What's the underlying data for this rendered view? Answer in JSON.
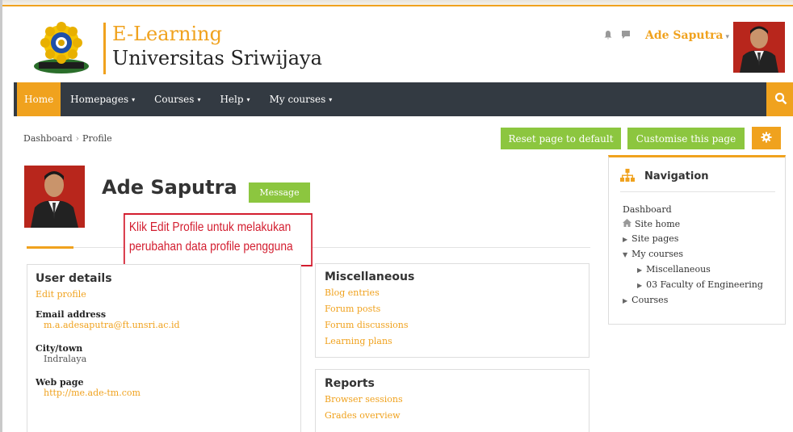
{
  "header": {
    "brand_line1": "E-Learning",
    "brand_line2": "Universitas Sriwijaya",
    "user_name": "Ade Saputra",
    "user_caret": "▾"
  },
  "navbar": {
    "items": [
      {
        "label": "Home"
      },
      {
        "label": "Homepages"
      },
      {
        "label": "Courses"
      },
      {
        "label": "Help"
      },
      {
        "label": "My courses"
      }
    ],
    "caret": "▾"
  },
  "breadcrumb": {
    "items": [
      "Dashboard",
      "Profile"
    ],
    "separator": "›"
  },
  "page_actions": {
    "reset_label": "Reset page to default",
    "customise_label": "Customise this page"
  },
  "profile": {
    "name": "Ade Saputra",
    "message_label": "Message"
  },
  "callout": {
    "line1": "Klik Edit Profile untuk melakukan",
    "line2": "perubahan data profile pengguna"
  },
  "user_details": {
    "title": "User details",
    "edit_link": "Edit profile",
    "email_label": "Email address",
    "email_value": "m.a.adesaputra@ft.unsri.ac.id",
    "city_label": "City/town",
    "city_value": "Indralaya",
    "web_label": "Web page",
    "web_value": "http://me.ade-tm.com"
  },
  "miscellaneous": {
    "title": "Miscellaneous",
    "links": [
      "Blog entries",
      "Forum posts",
      "Forum discussions",
      "Learning plans"
    ]
  },
  "reports": {
    "title": "Reports",
    "links": [
      "Browser sessions",
      "Grades overview"
    ]
  },
  "navigation": {
    "title": "Navigation",
    "items": {
      "dashboard": "Dashboard",
      "site_home": "Site home",
      "site_pages": "Site pages",
      "my_courses": "My courses",
      "misc": "Miscellaneous",
      "faculty": "03 Faculty of Engineering",
      "courses": "Courses"
    }
  },
  "colors": {
    "accent": "#f0a21e",
    "navbar": "#333a42",
    "button_green": "#8cc63f",
    "callout_red": "#d31d2f"
  }
}
